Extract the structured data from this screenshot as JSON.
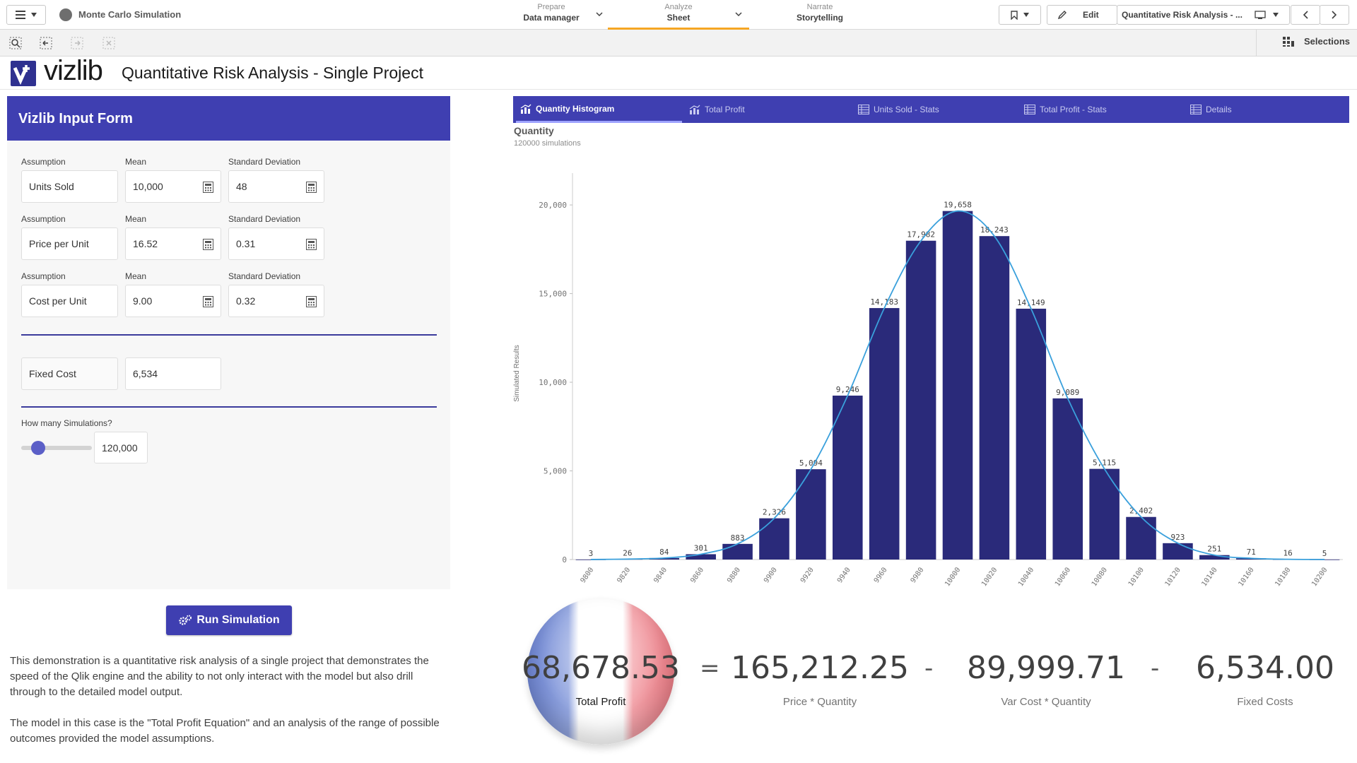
{
  "app": {
    "name": "Monte Carlo Simulation"
  },
  "nav": {
    "prepare": {
      "sub": "Prepare",
      "main": "Data manager"
    },
    "analyze": {
      "sub": "Analyze",
      "main": "Sheet"
    },
    "narrate": {
      "sub": "Narrate",
      "main": "Storytelling"
    }
  },
  "toolbar": {
    "edit_label": "Edit",
    "sheet_name": "Quantitative Risk Analysis - ...",
    "selections_label": "Selections"
  },
  "header": {
    "logo_text": "vizlib",
    "title": "Quantitative Risk Analysis - Single Project"
  },
  "form": {
    "title": "Vizlib Input Form",
    "rows": [
      {
        "assumption_label": "Assumption",
        "mean_label": "Mean",
        "sd_label": "Standard Deviation",
        "assumption": "Units Sold",
        "mean": "10,000",
        "sd": "48"
      },
      {
        "assumption_label": "Assumption",
        "mean_label": "Mean",
        "sd_label": "Standard Deviation",
        "assumption": "Price per Unit",
        "mean": "16.52",
        "sd": "0.31"
      },
      {
        "assumption_label": "Assumption",
        "mean_label": "Mean",
        "sd_label": "Standard Deviation",
        "assumption": "Cost per Unit",
        "mean": "9.00",
        "sd": "0.32"
      }
    ],
    "fixed_cost_label": "Fixed Cost",
    "fixed_cost": "6,534",
    "simulations_label": "How many Simulations?",
    "simulations": "120,000",
    "slider_fraction": 0.12
  },
  "run_button": "Run Simulation",
  "description": [
    "This demonstration is a quantitative risk analysis of a single project that demonstrates the speed of the Qlik engine and the ability to not only interact with the model but also drill through to the detailed model output.",
    "The model in this case is the \"Total Profit Equation\" and an analysis of the range of possible outcomes provided the model assumptions."
  ],
  "tabs": [
    {
      "label": "Quantity Histogram",
      "icon": "chart-icon",
      "active": true
    },
    {
      "label": "Total Profit",
      "icon": "chart-icon",
      "active": false
    },
    {
      "label": "Units Sold - Stats",
      "icon": "table-icon",
      "active": false
    },
    {
      "label": "Total Profit - Stats",
      "icon": "table-icon",
      "active": false
    },
    {
      "label": "Details",
      "icon": "table-icon",
      "active": false
    }
  ],
  "chart_title": "Quantity",
  "chart_subtitle": "120000 simulations",
  "chart_data": {
    "type": "bar",
    "title": "Quantity",
    "subtitle": "120000 simulations",
    "xlabel": "",
    "ylabel": "Simulated Results",
    "categories": [
      "9800",
      "9820",
      "9840",
      "9860",
      "9880",
      "9900",
      "9920",
      "9940",
      "9960",
      "9980",
      "10000",
      "10020",
      "10040",
      "10060",
      "10080",
      "10100",
      "10120",
      "10140",
      "10160",
      "10180",
      "10200"
    ],
    "values": [
      3,
      26,
      84,
      301,
      883,
      2326,
      5094,
      9246,
      14183,
      17982,
      19658,
      18243,
      14149,
      9089,
      5115,
      2402,
      923,
      251,
      71,
      16,
      5
    ],
    "value_labels": [
      "3",
      "26",
      "84",
      "301",
      "883",
      "2,326",
      "5,094",
      "9,246",
      "14,183",
      "17,982",
      "19,658",
      "18,243",
      "14,149",
      "9,089",
      "5,115",
      "2,402",
      "923",
      "251",
      "71",
      "16",
      "5"
    ],
    "ylim": [
      0,
      21000
    ],
    "yticks": [
      0,
      5000,
      10000,
      15000,
      20000
    ],
    "ytick_labels": [
      "0",
      "5,000",
      "10,000",
      "15,000",
      "20,000"
    ],
    "overlay": "normal-curve",
    "grid": false,
    "colors": {
      "bar": "#2a2a7a",
      "curve": "#3aa0dc"
    }
  },
  "kpi": {
    "total_profit": "68,678.53",
    "total_profit_label": "Total Profit",
    "eq": "=",
    "minus": "-",
    "price_qty": "165,212.25",
    "price_qty_label": "Price * Quantity",
    "var_cost": "89,999.71",
    "var_cost_label": "Var Cost * Quantity",
    "fixed": "6,534.00",
    "fixed_label": "Fixed Costs"
  },
  "colors": {
    "accent": "#3f3fb1",
    "analyze_underline": "#f5a623"
  }
}
